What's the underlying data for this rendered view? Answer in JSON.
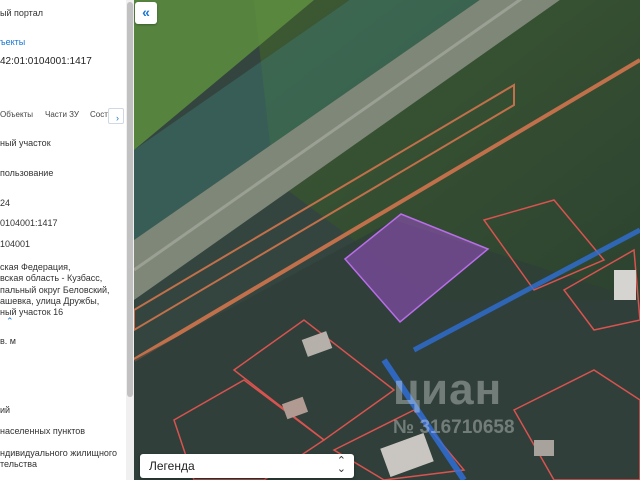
{
  "panel": {
    "portal_title": "ый портал",
    "objects_link": "ъекты",
    "cadastral_number": "42:01:0104001:1417",
    "tabs": [
      "Объекты",
      "Части ЗУ",
      "Состав"
    ],
    "fields": [
      "ный участок",
      "пользование",
      "24",
      "0104001:1417",
      "104001"
    ],
    "address_lines": [
      "ская Федерация,",
      "вская область - Кузбасс,",
      "пальный округ Беловский,",
      "ашевка, улица Дружбы,",
      "ный участок 16"
    ],
    "area_unit": "в. м",
    "bottom_lines": [
      "ий",
      "населенных пунктов",
      "ндивидуального жилищного",
      "тельства"
    ]
  },
  "map": {
    "collapse_icon": "«",
    "legend_label": "Легенда",
    "watermark": "циан",
    "watermark_id": "№ 316710658"
  }
}
